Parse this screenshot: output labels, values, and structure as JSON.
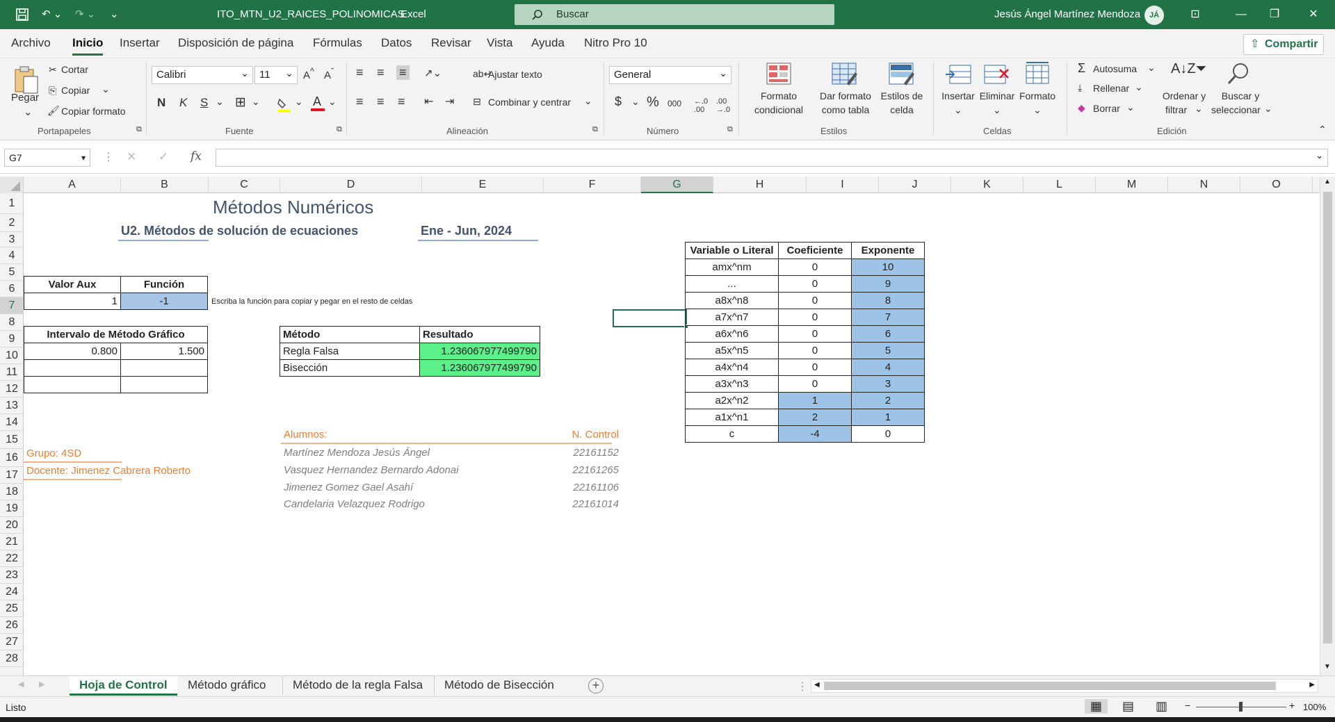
{
  "titlebar": {
    "filename": "ITO_MTN_U2_RAICES_POLINOMICAS",
    "sep": "-",
    "app": "Excel",
    "search_placeholder": "Buscar",
    "user": "Jesús Ángel Martínez Mendoza",
    "initials": "JÁ"
  },
  "menu": [
    "Archivo",
    "Inicio",
    "Insertar",
    "Disposición de página",
    "Fórmulas",
    "Datos",
    "Revisar",
    "Vista",
    "Ayuda",
    "Nitro Pro 10"
  ],
  "share_label": "Compartir",
  "ribbon": {
    "paste": "Pegar",
    "cut": "Cortar",
    "copy": "Copiar",
    "format_painter": "Copiar formato",
    "group_clipboard": "Portapapeles",
    "font_name": "Calibri",
    "font_size": "11",
    "bold": "N",
    "italic": "K",
    "underline": "S",
    "group_font": "Fuente",
    "wrap_text": "Ajustar texto",
    "merge_center": "Combinar y centrar",
    "group_alignment": "Alineación",
    "number_format": "General",
    "currency": "$",
    "percent": "%",
    "thousands": "000",
    "group_number": "Número",
    "cond_format_1": "Formato",
    "cond_format_2": "condicional",
    "format_table_1": "Dar formato",
    "format_table_2": "como tabla",
    "cell_styles_1": "Estilos de",
    "cell_styles_2": "celda",
    "group_styles": "Estilos",
    "insert": "Insertar",
    "delete": "Eliminar",
    "format": "Formato",
    "group_cells": "Celdas",
    "autosum": "Autosuma",
    "fill": "Rellenar",
    "clear": "Borrar",
    "sort_1": "Ordenar y",
    "sort_2": "filtrar",
    "find_1": "Buscar y",
    "find_2": "seleccionar",
    "group_editing": "Edición"
  },
  "namebox": "G7",
  "fx": "fx",
  "columns": [
    "A",
    "B",
    "C",
    "D",
    "E",
    "F",
    "G",
    "H",
    "I",
    "J",
    "K",
    "L",
    "M",
    "N",
    "O"
  ],
  "rows": [
    "1",
    "2",
    "3",
    "4",
    "5",
    "6",
    "7",
    "8",
    "9",
    "10",
    "11",
    "12",
    "13",
    "14",
    "15",
    "16",
    "17",
    "18",
    "19",
    "20",
    "21",
    "22",
    "23",
    "24",
    "25",
    "26",
    "27",
    "28"
  ],
  "sheet": {
    "title": "Métodos Numéricos",
    "subtitle": "U2. Métodos de solución de ecuaciones",
    "period": "Ene - Jun, 2024",
    "valor_aux_h": "Valor Aux",
    "funcion_h": "Función",
    "valor_aux": "1",
    "funcion": "-1",
    "note": "Escriba la función para copiar y pegar en el resto de celdas",
    "intervalo_h": "Intervalo de Método Gráfico",
    "int_a": "0.800",
    "int_b": "1.500",
    "metodo_h": "Método",
    "resultado_h": "Resultado",
    "regla_falsa": "Regla Falsa",
    "regla_falsa_val": "1.236067977499790",
    "biseccion": "Bisección",
    "biseccion_val": "1.236067977499790",
    "alumnos_h": "Alumnos:",
    "ncontrol_h": "N. Control",
    "alumnos": [
      {
        "name": "Martínez Mendoza Jesús Ángel",
        "id": "22161152"
      },
      {
        "name": "Vasquez Hernandez Bernardo Adonai",
        "id": "22161265"
      },
      {
        "name": "Jimenez Gomez Gael Asahí",
        "id": "22161106"
      },
      {
        "name": "Candelaria Velazquez Rodrigo",
        "id": "22161014"
      }
    ],
    "grupo": "Grupo: 4SD",
    "docente": "Docente: Jimenez Cabrera Roberto",
    "poly_h": [
      "Variable o Literal",
      "Coeficiente",
      "Exponente"
    ],
    "poly": [
      {
        "v": "amx^nm",
        "c": "0",
        "e": "10"
      },
      {
        "v": "...",
        "c": "0",
        "e": "9"
      },
      {
        "v": "a8x^n8",
        "c": "0",
        "e": "8"
      },
      {
        "v": "a7x^n7",
        "c": "0",
        "e": "7"
      },
      {
        "v": "a6x^n6",
        "c": "0",
        "e": "6"
      },
      {
        "v": "a5x^n5",
        "c": "0",
        "e": "5"
      },
      {
        "v": "a4x^n4",
        "c": "0",
        "e": "4"
      },
      {
        "v": "a3x^n3",
        "c": "0",
        "e": "3"
      },
      {
        "v": "a2x^n2",
        "c": "1",
        "e": "2"
      },
      {
        "v": "a1x^n1",
        "c": "2",
        "e": "1"
      },
      {
        "v": "c",
        "c": "-4",
        "e": "0"
      }
    ]
  },
  "tabs": [
    "Hoja de Control",
    "Método gráfico",
    "Método de la regla Falsa",
    "Método de Bisección"
  ],
  "status": {
    "ready": "Listo",
    "zoom": "100%"
  }
}
